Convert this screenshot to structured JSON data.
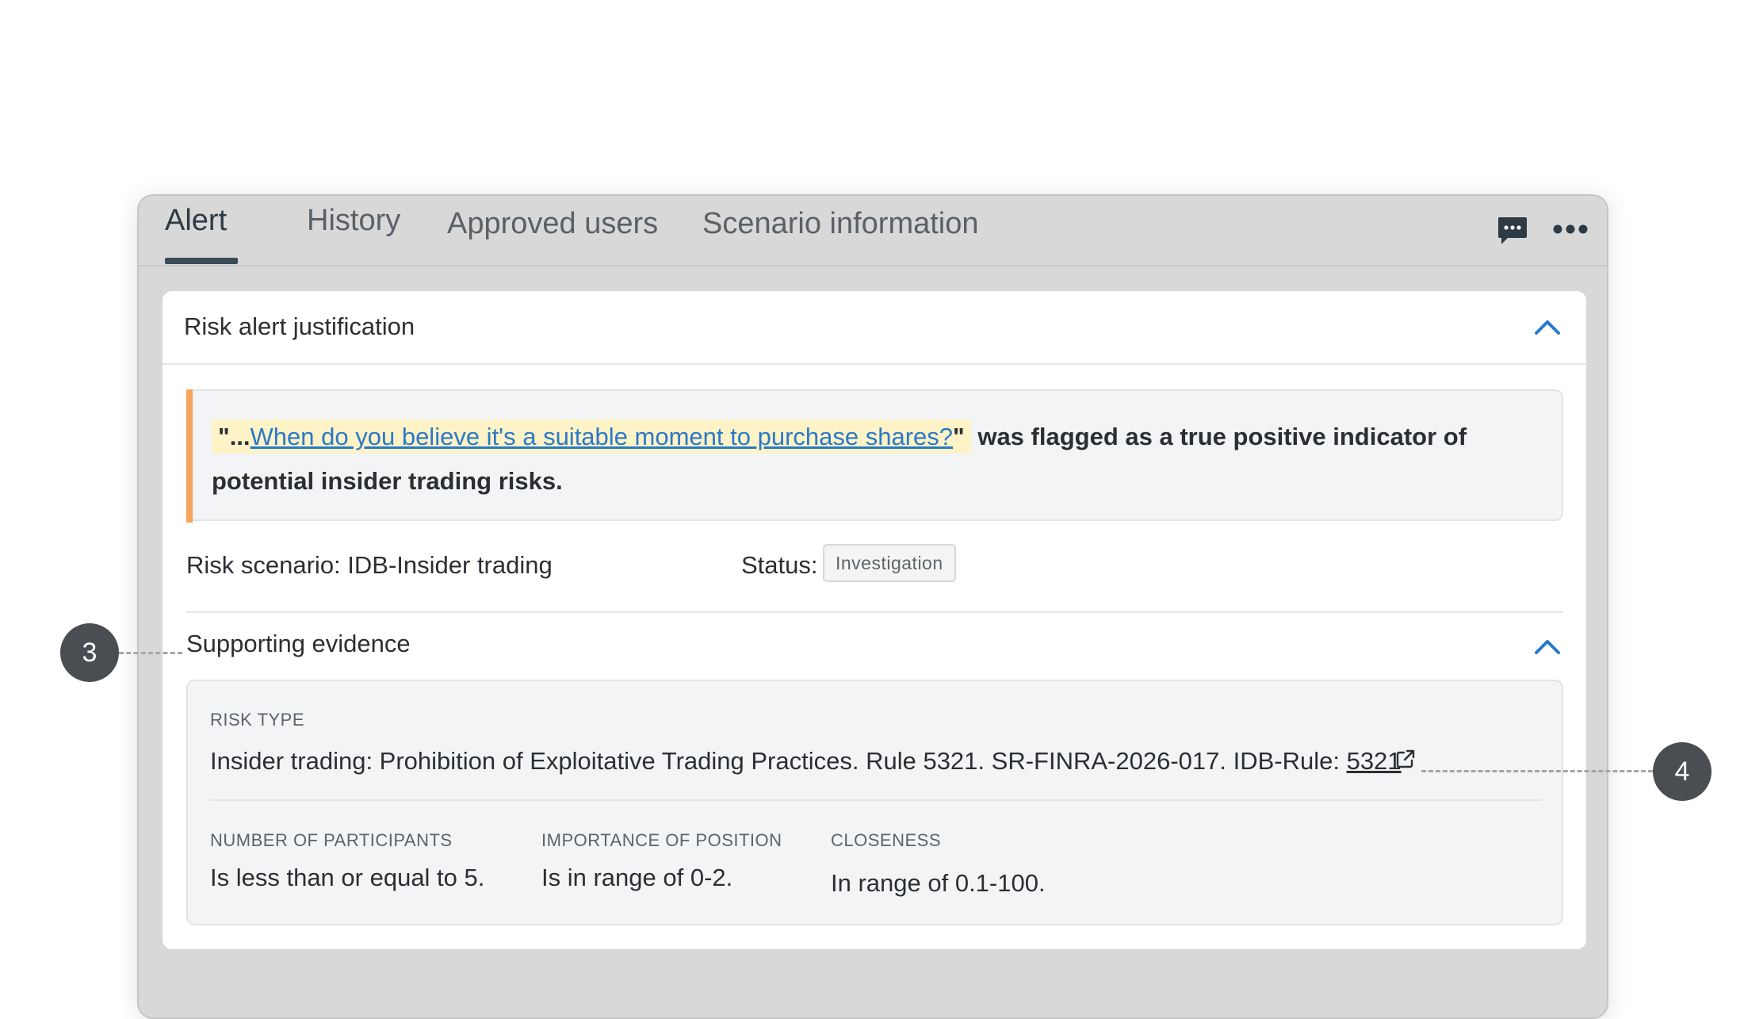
{
  "tabs": [
    {
      "label": "Alert",
      "active": true
    },
    {
      "label": "History"
    },
    {
      "label": "Approved users"
    },
    {
      "label": "Scenario information"
    }
  ],
  "toolbar": {
    "chat_icon": "chat-icon",
    "more_icon": "more-icon"
  },
  "card": {
    "title": "Risk alert justification",
    "quote": {
      "prefix": "\"...",
      "link_text": "When do you believe it's a suitable moment to purchase shares?",
      "suffix_quote": "\"",
      "rest": " was flagged as a true positive indicator of potential insider trading risks."
    },
    "risk_scenario": "Risk scenario: IDB-Insider trading",
    "status_label": "Status:",
    "status_badge": "Investigation",
    "evidence": {
      "title": "Supporting evidence",
      "risk_type_label": "RISK TYPE",
      "risk_type_text": "Insider trading: Prohibition of Exploitative Trading Practices. Rule 5321. SR-FINRA-2026-017. IDB-Rule: ",
      "rule_link": "5321",
      "participants_label": "NUMBER OF PARTICIPANTS",
      "participants_value": "Is less than or equal to 5.",
      "importance_label": "IMPORTANCE OF POSITION",
      "importance_value": "Is in range of 0-2.",
      "closeness_label": "CLOSENESS",
      "closeness_value": "In range of 0.1-100."
    }
  },
  "callouts": {
    "left": "3",
    "right": "4"
  },
  "colors": {
    "accent": "#2a79c9",
    "quote_bar": "#f6a35b",
    "highlight": "#fdf3c7"
  }
}
